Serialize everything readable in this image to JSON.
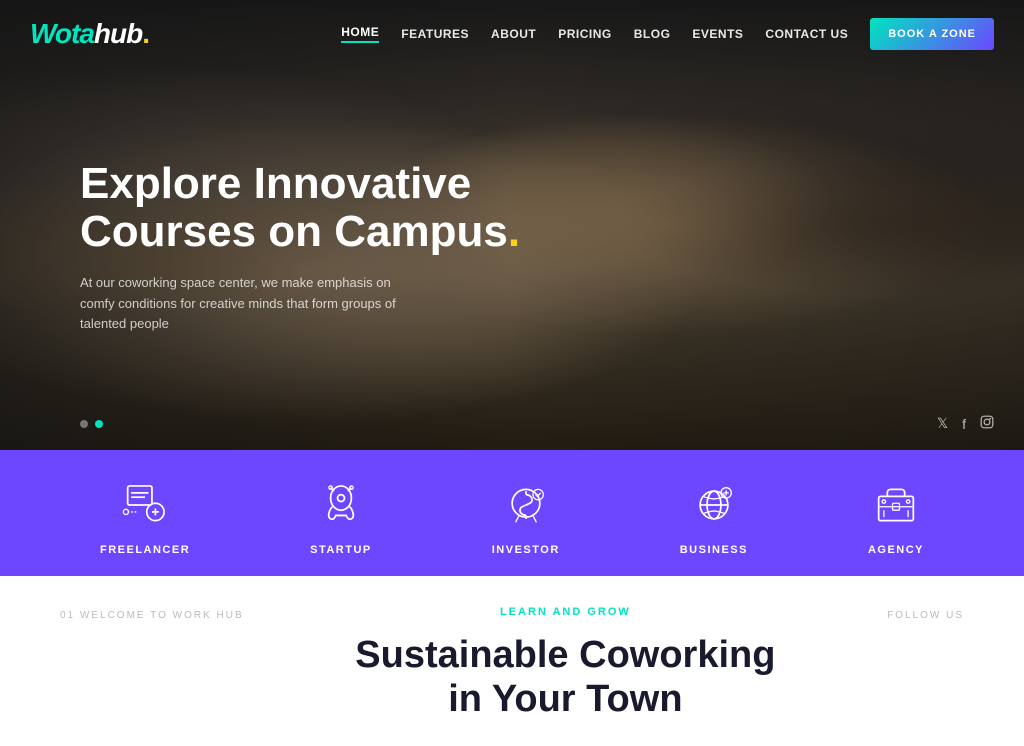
{
  "logo": {
    "wota": "Wota",
    "hub": "hub",
    "dot": "."
  },
  "nav": {
    "items": [
      {
        "label": "HOME",
        "active": true
      },
      {
        "label": "FEATURES",
        "active": false
      },
      {
        "label": "ABOUT",
        "active": false
      },
      {
        "label": "PRICING",
        "active": false
      },
      {
        "label": "BLOG",
        "active": false
      },
      {
        "label": "EVENTS",
        "active": false
      },
      {
        "label": "CONTACT US",
        "active": false
      }
    ],
    "cta_label": "BOOK A ZONE"
  },
  "hero": {
    "title_line1": "Explore Innovative",
    "title_line2": "Courses on Campus",
    "title_accent": ".",
    "subtitle": "At our coworking space center, we make emphasis on comfy conditions for creative minds that form groups of talented people",
    "dots": [
      false,
      true
    ],
    "social": [
      "𝕏",
      "f",
      "⊙"
    ]
  },
  "band": {
    "items": [
      {
        "label": "FREELANCER",
        "icon": "freelancer"
      },
      {
        "label": "STARTUP",
        "icon": "startup"
      },
      {
        "label": "INVESTOR",
        "icon": "investor"
      },
      {
        "label": "BUSINESS",
        "icon": "business"
      },
      {
        "label": "AGENCY",
        "icon": "agency"
      }
    ]
  },
  "bottom": {
    "left_label": "01 WELCOME TO WORK HUB",
    "right_label": "FOLLOW US",
    "tag": "LEARN AND GROW",
    "heading_line1": "Sustainable Coworking",
    "heading_line2": "in Your Town"
  },
  "colors": {
    "accent": "#00e5c0",
    "purple": "#6c47ff",
    "yellow": "#f5d020",
    "dark": "#1a1a2e"
  }
}
